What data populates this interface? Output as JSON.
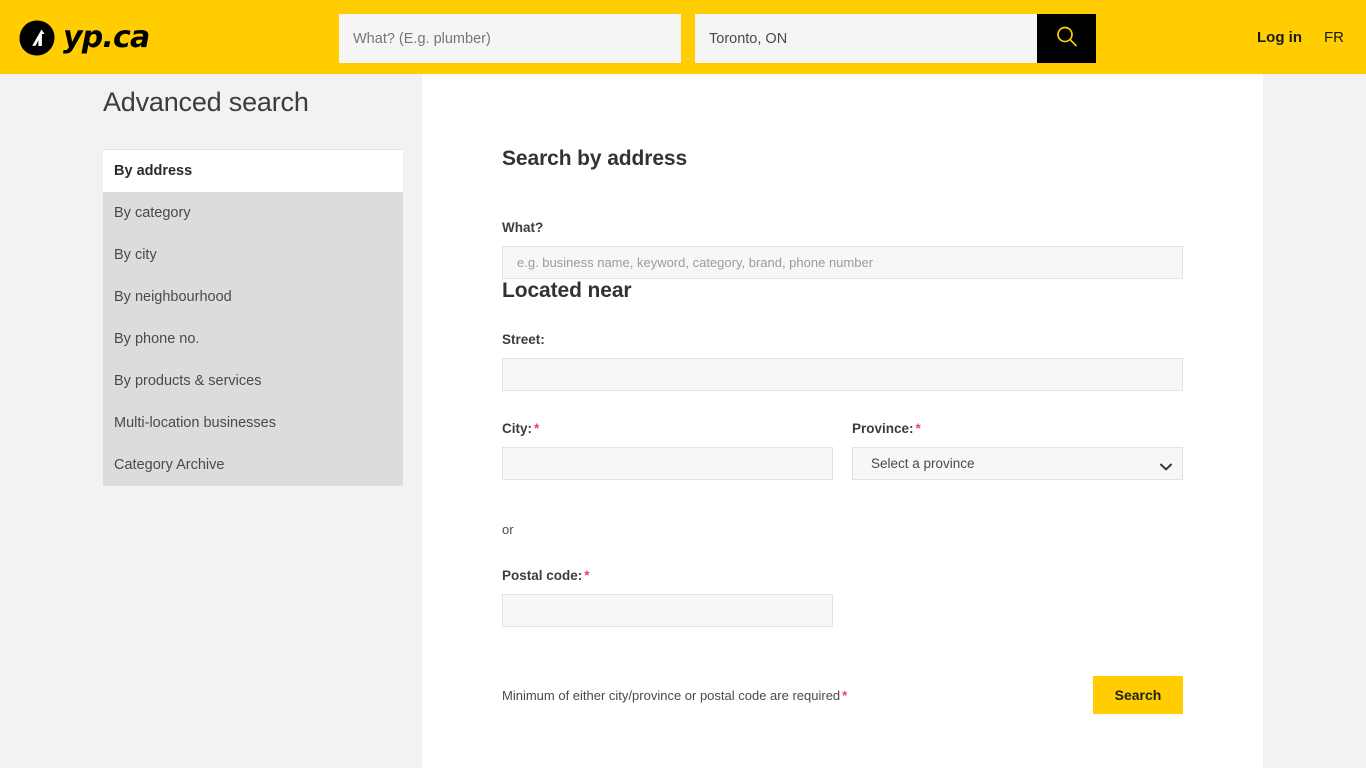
{
  "header": {
    "logo_text": "yp.ca",
    "logo_icon": "yp-arrow-logo-icon",
    "what_placeholder": "What? (E.g. plumber)",
    "what_value": "",
    "where_placeholder": "",
    "where_value": "Toronto, ON",
    "search_icon": "magnifier-icon",
    "login_label": "Log in",
    "language_label": "FR",
    "background_color": "#ffcd00"
  },
  "sidebar": {
    "title": "Advanced search",
    "items": [
      {
        "label": "By address",
        "active": true
      },
      {
        "label": "By category",
        "active": false
      },
      {
        "label": "By city",
        "active": false
      },
      {
        "label": "By neighbourhood",
        "active": false
      },
      {
        "label": "By phone no.",
        "active": false
      },
      {
        "label": "By products & services",
        "active": false
      },
      {
        "label": "Multi-location businesses",
        "active": false
      },
      {
        "label": "Category Archive",
        "active": false
      }
    ]
  },
  "main": {
    "heading": "Search by address",
    "what": {
      "label": "What?",
      "placeholder": "e.g. business name, keyword, category, brand, phone number",
      "value": ""
    },
    "located_near_heading": "Located near",
    "street": {
      "label": "Street:",
      "placeholder": "",
      "value": ""
    },
    "city": {
      "label": "City:",
      "required_mark": "*",
      "placeholder": "",
      "value": ""
    },
    "province": {
      "label": "Province:",
      "required_mark": "*",
      "selected": "Select a province",
      "options": [
        "Select a province"
      ],
      "chevron_icon": "chevron-down-icon"
    },
    "or_text": "or",
    "postal_code": {
      "label": "Postal code:",
      "required_mark": "*",
      "placeholder": "",
      "value": ""
    },
    "requirement_note": "Minimum of either city/province or postal code are required",
    "requirement_note_mark": "*",
    "search_button_label": "Search"
  },
  "colors": {
    "brand_yellow": "#ffcd00",
    "page_background": "#f2f2f2",
    "panel_white": "#ffffff",
    "nav_gray": "#dcdcdc",
    "required_red": "#e04a5f"
  }
}
